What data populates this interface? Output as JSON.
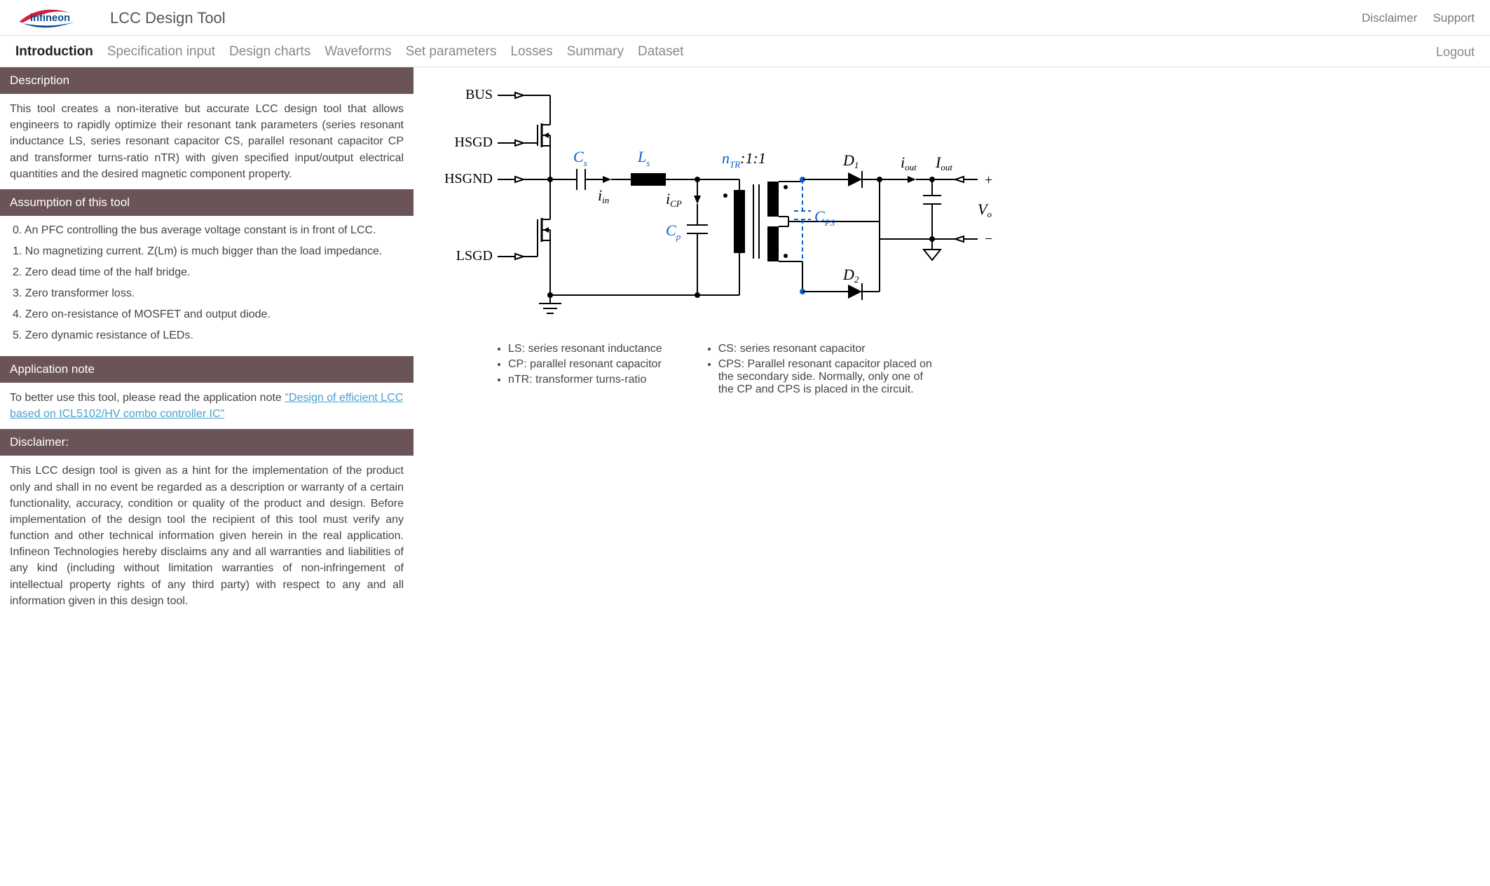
{
  "header": {
    "app_title": "LCC Design Tool",
    "disclaimer_link": "Disclaimer",
    "support_link": "Support"
  },
  "tabs": {
    "items": [
      "Introduction",
      "Specification input",
      "Design charts",
      "Waveforms",
      "Set parameters",
      "Losses",
      "Summary",
      "Dataset"
    ],
    "active_index": 0,
    "logout": "Logout"
  },
  "sections": {
    "description": {
      "title": "Description",
      "body": "This tool creates a non-iterative but accurate LCC design tool that allows engineers to rapidly optimize their resonant tank parameters (series resonant inductance LS, series resonant capacitor CS, parallel resonant capacitor CP and transformer turns-ratio nTR) with given specified input/output electrical quantities and the desired magnetic component property."
    },
    "assumption": {
      "title": "Assumption of this tool",
      "items": [
        "0. An PFC controlling the bus average voltage constant is in front of LCC.",
        "1. No magnetizing current. Z(Lm) is much bigger than the load impedance.",
        "2. Zero dead time of the half bridge.",
        "3. Zero transformer loss.",
        "4. Zero on-resistance of MOSFET and output diode.",
        "5. Zero dynamic resistance of LEDs."
      ]
    },
    "app_note": {
      "title": "Application note",
      "lead": "To better use this tool, please read the application note ",
      "link_text": "\"Design of efficient LCC based on ICL5102/HV combo controller IC\""
    },
    "disclaimer": {
      "title": "Disclaimer:",
      "body": "This LCC design tool is given as a hint for the implementation of the product only and shall in no event be regarded as a description or warranty of a certain functionality, accuracy, condition or quality of the product and design. Before implementation of the design tool the recipient of this tool must verify any function and other technical information given herein in the real application. Infineon Technologies hereby disclaims any and all warranties and liabilities of any kind (including without limitation warranties of non-infringement of intellectual property rights of any third party) with respect to any and all information given in this design tool."
    }
  },
  "diagram": {
    "pins": {
      "bus": "BUS",
      "hsgd": "HSGD",
      "hsgnd": "HSGND",
      "lsgd": "LSGD"
    },
    "labels": {
      "cs": "C",
      "cs_sub": "s",
      "ls": "L",
      "ls_sub": "s",
      "iin": "i",
      "iin_sub": "in",
      "icp": "i",
      "icp_sub": "CP",
      "cp": "C",
      "cp_sub": "p",
      "ntr": "n",
      "ntr_sub": "TR",
      "ntr_after": ":1:1",
      "cps": "C",
      "cps_sub": "PS",
      "d1": "D",
      "d1_sub": "1",
      "d2": "D",
      "d2_sub": "2",
      "iout": "i",
      "iout_sub": "out",
      "Iout": "I",
      "Iout_sub": "out",
      "vo": "V",
      "vo_sub": "o",
      "plus": "+",
      "minus": "−"
    }
  },
  "legend": {
    "left": [
      "LS: series resonant inductance",
      "CP: parallel resonant capacitor",
      "nTR: transformer turns-ratio"
    ],
    "right": [
      "CS: series resonant capacitor",
      "CPS: Parallel resonant capacitor placed on the secondary side. Normally, only one of the CP and CPS is placed in the circuit."
    ]
  }
}
